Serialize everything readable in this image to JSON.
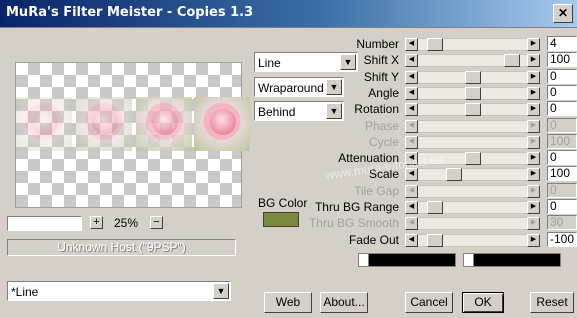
{
  "window": {
    "title": "MuRa's Filter Meister - Copies 1.3",
    "close_glyph": "✕"
  },
  "preview": {
    "zoom_percent": "25%",
    "zoom_plus": "+",
    "zoom_minus": "−",
    "host_label": "Unknown Host (\"9PSP\")"
  },
  "preset": {
    "selected": "*Line"
  },
  "dropdowns": {
    "mode": "Line",
    "wrap": "Wraparound",
    "order": "Behind"
  },
  "bg_color": {
    "label": "BG Color",
    "value": "#7a8a3c"
  },
  "sliders": [
    {
      "label": "Number",
      "value": "4",
      "position": 0.1,
      "disabled": false
    },
    {
      "label": "Shift X",
      "value": "100",
      "position": 0.93,
      "disabled": false
    },
    {
      "label": "Shift Y",
      "value": "0",
      "position": 0.5,
      "disabled": false
    },
    {
      "label": "Angle",
      "value": "0",
      "position": 0.5,
      "disabled": false
    },
    {
      "label": "Rotation",
      "value": "0",
      "position": 0.5,
      "disabled": false
    },
    {
      "label": "Phase",
      "value": "0",
      "position": 0.0,
      "disabled": true
    },
    {
      "label": "Cycle",
      "value": "100",
      "position": 0.0,
      "disabled": true
    },
    {
      "label": "Attenuation",
      "value": "0",
      "position": 0.5,
      "disabled": false
    },
    {
      "label": "Scale",
      "value": "100",
      "position": 0.3,
      "disabled": false
    },
    {
      "label": "Tile Gap",
      "value": "0",
      "position": 0.0,
      "disabled": true
    },
    {
      "label": "Thru BG Range",
      "value": "0",
      "position": 0.1,
      "disabled": false
    },
    {
      "label": "Thru BG Smooth",
      "value": "30",
      "position": 0.0,
      "disabled": true
    },
    {
      "label": "Fade Out",
      "value": "-100",
      "position": 0.1,
      "disabled": false
    }
  ],
  "buttons": {
    "web": "Web",
    "about": "About...",
    "cancel": "Cancel",
    "ok": "OK",
    "reset": "Reset"
  },
  "watermark": "www.mura-tutorials.eu"
}
